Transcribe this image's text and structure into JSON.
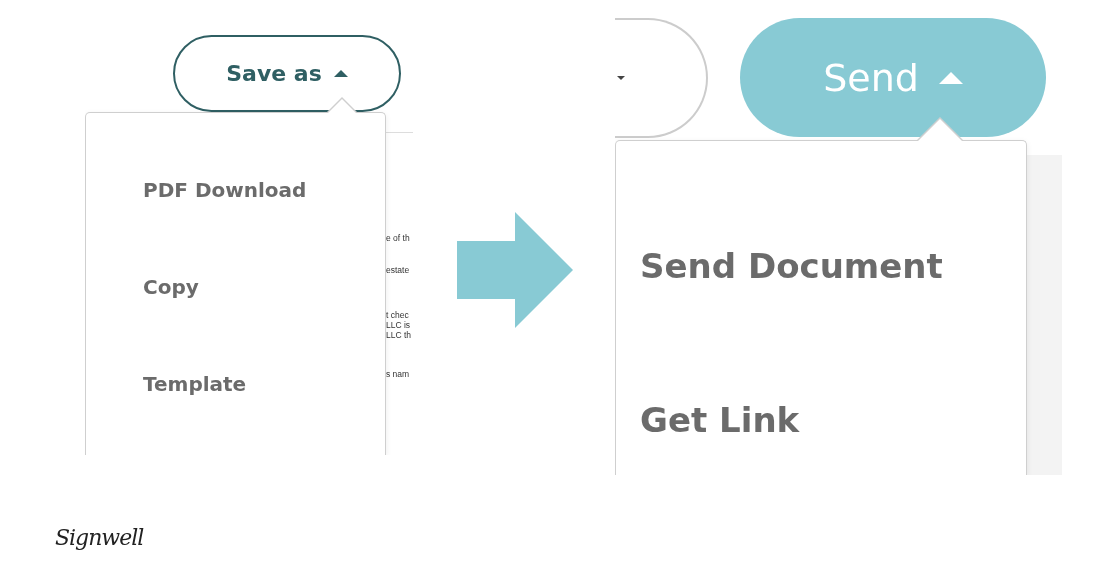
{
  "save_as": {
    "button": {
      "label": "Save as",
      "expanded": true
    },
    "menu": [
      "PDF Download",
      "Copy",
      "Template"
    ],
    "document_fragments": [
      "e of th",
      "estate",
      "t chec",
      "LLC is",
      "LLC th",
      "s nam"
    ]
  },
  "send": {
    "button": {
      "label": "Send",
      "expanded": true
    },
    "menu": [
      "Send Document",
      "Get Link"
    ]
  },
  "logo": "Signwell"
}
